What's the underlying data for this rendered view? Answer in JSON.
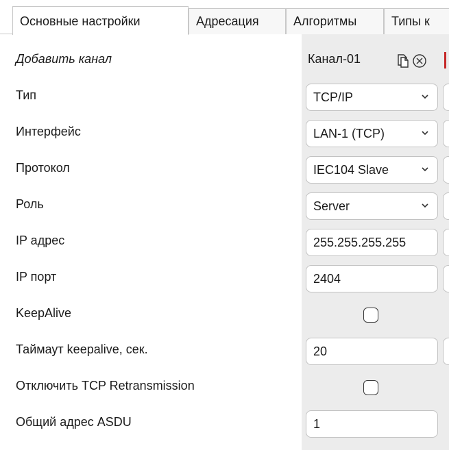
{
  "tabs": [
    {
      "label": "Основные настройки"
    },
    {
      "label": "Адресация"
    },
    {
      "label": "Алгоритмы"
    },
    {
      "label": "Типы к"
    }
  ],
  "add_channel": {
    "label": "Добавить канал"
  },
  "channel": {
    "name": "Канал-01"
  },
  "rows": {
    "type": {
      "label": "Тип",
      "value": "TCP/IP"
    },
    "interface": {
      "label": "Интерфейс",
      "value": "LAN-1 (TCP)"
    },
    "protocol": {
      "label": "Протокол",
      "value": "IEC104 Slave"
    },
    "role": {
      "label": "Роль",
      "value": "Server"
    },
    "ip_address": {
      "label": "IP адрес",
      "value": "255.255.255.255"
    },
    "ip_port": {
      "label": "IP порт",
      "value": "2404"
    },
    "keepalive": {
      "label": "KeepAlive",
      "checked": false
    },
    "keepalive_timeout": {
      "label": "Таймаут keepalive, сек.",
      "value": "20"
    },
    "disable_tcp_retransmission": {
      "label": "Отключить TCP Retransmission",
      "checked": false
    },
    "asdu_address": {
      "label": "Общий адрес ASDU",
      "value": "1"
    }
  },
  "icons": {
    "copy": "copy-icon",
    "remove": "close-circle-icon",
    "dropdown": "chevron-down-icon"
  },
  "colors": {
    "remove_accent": "#c62828",
    "value_column_bg": "#ececec"
  }
}
